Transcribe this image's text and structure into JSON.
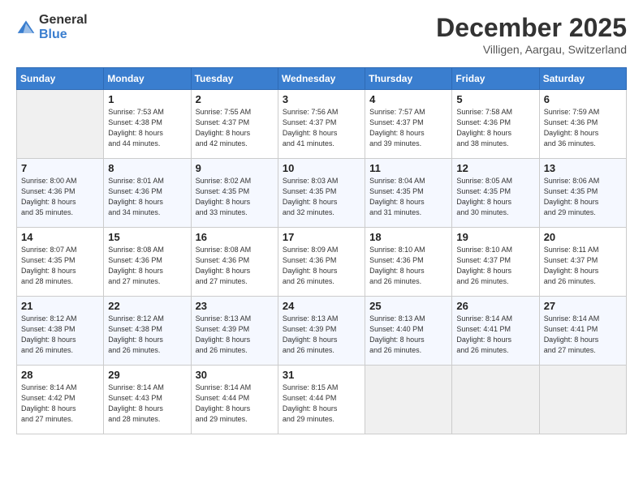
{
  "header": {
    "logo_general": "General",
    "logo_blue": "Blue",
    "month_title": "December 2025",
    "location": "Villigen, Aargau, Switzerland"
  },
  "days_of_week": [
    "Sunday",
    "Monday",
    "Tuesday",
    "Wednesday",
    "Thursday",
    "Friday",
    "Saturday"
  ],
  "weeks": [
    [
      {
        "day": "",
        "info": ""
      },
      {
        "day": "1",
        "info": "Sunrise: 7:53 AM\nSunset: 4:38 PM\nDaylight: 8 hours\nand 44 minutes."
      },
      {
        "day": "2",
        "info": "Sunrise: 7:55 AM\nSunset: 4:37 PM\nDaylight: 8 hours\nand 42 minutes."
      },
      {
        "day": "3",
        "info": "Sunrise: 7:56 AM\nSunset: 4:37 PM\nDaylight: 8 hours\nand 41 minutes."
      },
      {
        "day": "4",
        "info": "Sunrise: 7:57 AM\nSunset: 4:37 PM\nDaylight: 8 hours\nand 39 minutes."
      },
      {
        "day": "5",
        "info": "Sunrise: 7:58 AM\nSunset: 4:36 PM\nDaylight: 8 hours\nand 38 minutes."
      },
      {
        "day": "6",
        "info": "Sunrise: 7:59 AM\nSunset: 4:36 PM\nDaylight: 8 hours\nand 36 minutes."
      }
    ],
    [
      {
        "day": "7",
        "info": "Sunrise: 8:00 AM\nSunset: 4:36 PM\nDaylight: 8 hours\nand 35 minutes."
      },
      {
        "day": "8",
        "info": "Sunrise: 8:01 AM\nSunset: 4:36 PM\nDaylight: 8 hours\nand 34 minutes."
      },
      {
        "day": "9",
        "info": "Sunrise: 8:02 AM\nSunset: 4:35 PM\nDaylight: 8 hours\nand 33 minutes."
      },
      {
        "day": "10",
        "info": "Sunrise: 8:03 AM\nSunset: 4:35 PM\nDaylight: 8 hours\nand 32 minutes."
      },
      {
        "day": "11",
        "info": "Sunrise: 8:04 AM\nSunset: 4:35 PM\nDaylight: 8 hours\nand 31 minutes."
      },
      {
        "day": "12",
        "info": "Sunrise: 8:05 AM\nSunset: 4:35 PM\nDaylight: 8 hours\nand 30 minutes."
      },
      {
        "day": "13",
        "info": "Sunrise: 8:06 AM\nSunset: 4:35 PM\nDaylight: 8 hours\nand 29 minutes."
      }
    ],
    [
      {
        "day": "14",
        "info": "Sunrise: 8:07 AM\nSunset: 4:35 PM\nDaylight: 8 hours\nand 28 minutes."
      },
      {
        "day": "15",
        "info": "Sunrise: 8:08 AM\nSunset: 4:36 PM\nDaylight: 8 hours\nand 27 minutes."
      },
      {
        "day": "16",
        "info": "Sunrise: 8:08 AM\nSunset: 4:36 PM\nDaylight: 8 hours\nand 27 minutes."
      },
      {
        "day": "17",
        "info": "Sunrise: 8:09 AM\nSunset: 4:36 PM\nDaylight: 8 hours\nand 26 minutes."
      },
      {
        "day": "18",
        "info": "Sunrise: 8:10 AM\nSunset: 4:36 PM\nDaylight: 8 hours\nand 26 minutes."
      },
      {
        "day": "19",
        "info": "Sunrise: 8:10 AM\nSunset: 4:37 PM\nDaylight: 8 hours\nand 26 minutes."
      },
      {
        "day": "20",
        "info": "Sunrise: 8:11 AM\nSunset: 4:37 PM\nDaylight: 8 hours\nand 26 minutes."
      }
    ],
    [
      {
        "day": "21",
        "info": "Sunrise: 8:12 AM\nSunset: 4:38 PM\nDaylight: 8 hours\nand 26 minutes."
      },
      {
        "day": "22",
        "info": "Sunrise: 8:12 AM\nSunset: 4:38 PM\nDaylight: 8 hours\nand 26 minutes."
      },
      {
        "day": "23",
        "info": "Sunrise: 8:13 AM\nSunset: 4:39 PM\nDaylight: 8 hours\nand 26 minutes."
      },
      {
        "day": "24",
        "info": "Sunrise: 8:13 AM\nSunset: 4:39 PM\nDaylight: 8 hours\nand 26 minutes."
      },
      {
        "day": "25",
        "info": "Sunrise: 8:13 AM\nSunset: 4:40 PM\nDaylight: 8 hours\nand 26 minutes."
      },
      {
        "day": "26",
        "info": "Sunrise: 8:14 AM\nSunset: 4:41 PM\nDaylight: 8 hours\nand 26 minutes."
      },
      {
        "day": "27",
        "info": "Sunrise: 8:14 AM\nSunset: 4:41 PM\nDaylight: 8 hours\nand 27 minutes."
      }
    ],
    [
      {
        "day": "28",
        "info": "Sunrise: 8:14 AM\nSunset: 4:42 PM\nDaylight: 8 hours\nand 27 minutes."
      },
      {
        "day": "29",
        "info": "Sunrise: 8:14 AM\nSunset: 4:43 PM\nDaylight: 8 hours\nand 28 minutes."
      },
      {
        "day": "30",
        "info": "Sunrise: 8:14 AM\nSunset: 4:44 PM\nDaylight: 8 hours\nand 29 minutes."
      },
      {
        "day": "31",
        "info": "Sunrise: 8:15 AM\nSunset: 4:44 PM\nDaylight: 8 hours\nand 29 minutes."
      },
      {
        "day": "",
        "info": ""
      },
      {
        "day": "",
        "info": ""
      },
      {
        "day": "",
        "info": ""
      }
    ]
  ]
}
